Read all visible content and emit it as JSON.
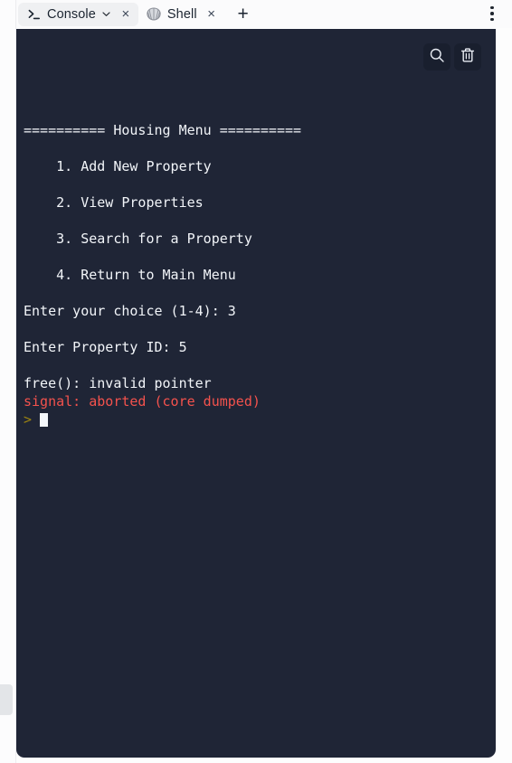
{
  "window": {
    "background": "#fdfdfd",
    "console_background": "#1f2536"
  },
  "tabbar": {
    "tabs": [
      {
        "id": "console",
        "label": "Console",
        "icon": "terminal-prompt-icon",
        "active": true,
        "has_dropdown": true,
        "dropdown_icon": "chevron-down-icon",
        "close_icon": "close-icon",
        "close_label": "×"
      },
      {
        "id": "shell",
        "label": "Shell",
        "icon": "seashell-icon",
        "active": false,
        "has_dropdown": false,
        "close_icon": "close-icon",
        "close_label": "×"
      }
    ],
    "new_tab": {
      "label": "+",
      "icon": "plus-icon"
    },
    "overflow_menu": {
      "icon": "kebab-menu-icon"
    }
  },
  "console": {
    "actions": [
      {
        "id": "search",
        "icon": "search-icon"
      },
      {
        "id": "clear",
        "icon": "trash-icon"
      }
    ],
    "output": [
      {
        "text": "========== Housing Menu ==========",
        "color": "#f2f5f9",
        "gap": true
      },
      {
        "text": "    1. Add New Property",
        "color": "#f2f5f9",
        "gap": true
      },
      {
        "text": "    2. View Properties",
        "color": "#f2f5f9",
        "gap": true
      },
      {
        "text": "    3. Search for a Property",
        "color": "#f2f5f9",
        "gap": true
      },
      {
        "text": "    4. Return to Main Menu",
        "color": "#f2f5f9",
        "gap": true
      },
      {
        "text": "Enter your choice (1-4): 3",
        "color": "#f2f5f9",
        "gap": true
      },
      {
        "text": "Enter Property ID: 5",
        "color": "#f2f5f9",
        "gap": true
      },
      {
        "text": "free(): invalid pointer",
        "color": "#f2f5f9",
        "gap": false
      },
      {
        "text": "signal: aborted (core dumped)",
        "color": "#f4524d",
        "gap": false
      }
    ],
    "prompt": {
      "symbol": ">",
      "symbol_color": "#9b8311",
      "cursor_color": "#f4f7fb"
    },
    "colors": {
      "text": "#f2f5f9",
      "error": "#f4524d",
      "prompt": "#9b8311",
      "background": "#1f2536",
      "button_background": "#191f2e"
    }
  }
}
